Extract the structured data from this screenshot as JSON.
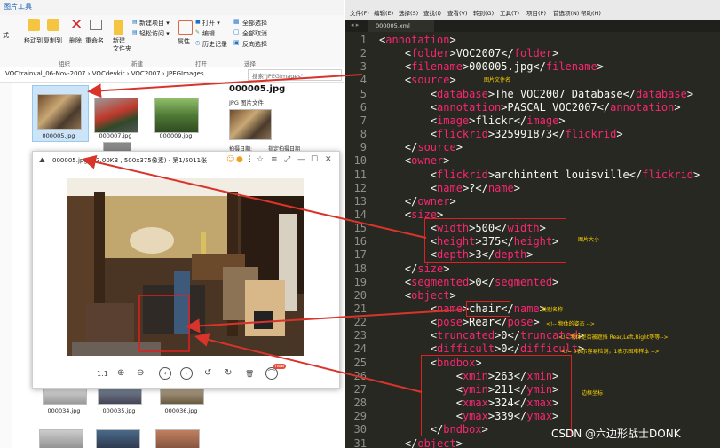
{
  "explorer": {
    "active_tab": "图片工具",
    "ribbon": {
      "left_edge": "式",
      "move_to": "移动到",
      "copy_to": "复制到",
      "delete": "删除",
      "rename": "重命名",
      "new_item": "新建项目 ▾",
      "easy_access": "轻松访问 ▾",
      "new_folder": "新建\n文件夹",
      "properties": "属性",
      "open": "打开 ▾",
      "edit": "编辑",
      "history": "历史记录",
      "select_all": "全部选择",
      "select_none": "全部取消",
      "invert": "反向选择",
      "group_organize": "组织",
      "group_new": "新建",
      "group_open": "打开",
      "group_select": "选择"
    },
    "address": {
      "crumbs": [
        "VOCtrainval_06-Nov-2007",
        "VOCdevkit",
        "VOC2007",
        "JPEGImages"
      ],
      "separator": "›",
      "search_placeholder": "搜索\"JPEGImages\""
    },
    "files": [
      {
        "name": "000005.jpg"
      },
      {
        "name": "000007.jpg"
      },
      {
        "name": "000009.jpg"
      },
      {
        "name": "000034.jpg"
      },
      {
        "name": "000035.jpg"
      },
      {
        "name": "000036.jpg"
      }
    ],
    "preview": {
      "title": "000005.jpg",
      "subtitle": "JPG 图片文件",
      "meta1": "拍摄日期:",
      "meta2": "指定拍摄日期"
    }
  },
  "viewer": {
    "title": "000005.jpg (93.00KB , 500x375像素) - 第1/5011张",
    "controls": [
      "⋮",
      "☆",
      "≡",
      "⤢",
      "—",
      "☐",
      "✕"
    ],
    "toolbar": {
      "actual_size": "1:1",
      "zoom_in": "⊕",
      "zoom_out": "⊖",
      "prev": "‹",
      "next": "›",
      "rotate_left": "↺",
      "rotate_right": "↻",
      "delete": "🗑",
      "more": "⌒",
      "new_badge": "new"
    }
  },
  "editor": {
    "menu": [
      "文件(F)",
      "编辑(E)",
      "选择(S)",
      "查找(I)",
      "查看(V)",
      "转到(G)",
      "工具(T)",
      "项目(P)",
      "首选项(N)",
      "帮助(H)"
    ],
    "tab_name": "000005.xml",
    "nav": "◂ ▸",
    "lines": [
      "<annotation>",
      "    <folder>VOC2007</folder>",
      "    <filename>000005.jpg</filename>",
      "    <source>",
      "        <database>The VOC2007 Database</database>",
      "        <annotation>PASCAL VOC2007</annotation>",
      "        <image>flickr</image>",
      "        <flickrid>325991873</flickrid>",
      "    </source>",
      "    <owner>",
      "        <flickrid>archintent louisville</flickrid>",
      "        <name>?</name>",
      "    </owner>",
      "    <size>",
      "        <width>500</width>",
      "        <height>375</height>",
      "        <depth>3</depth>",
      "    </size>",
      "    <segmented>0</segmented>",
      "    <object>",
      "        <name>chair</name>",
      "        <pose>Rear</pose>",
      "        <truncated>0</truncated>",
      "        <difficult>0</difficult>",
      "        <bndbox>",
      "            <xmin>263</xmin>",
      "            <ymin>211</ymin>",
      "            <xmax>324</xmax>",
      "            <ymax>339</ymax>",
      "        </bndbox>",
      "    </object>"
    ],
    "annotations": {
      "filename": "图片文件名",
      "size": "图片大小",
      "class_name": "类别名称",
      "pose": "<!-- 物体的姿态 -->",
      "truncated": "<!-- 物体是否被遮挡 Rear,Left,Right等等-->",
      "difficult": "<!-- 0表示容易检测，1表示困难样本 -->",
      "bbox": "边框坐标"
    },
    "watermark": "CSDN @六边形战士DONK"
  },
  "colors": {
    "editor_bg": "#272822",
    "tag": "#f92672",
    "text": "#f8f8f2",
    "line_number": "#8f908a",
    "highlight_box": "#e02020",
    "annotation": "#ffd400"
  }
}
